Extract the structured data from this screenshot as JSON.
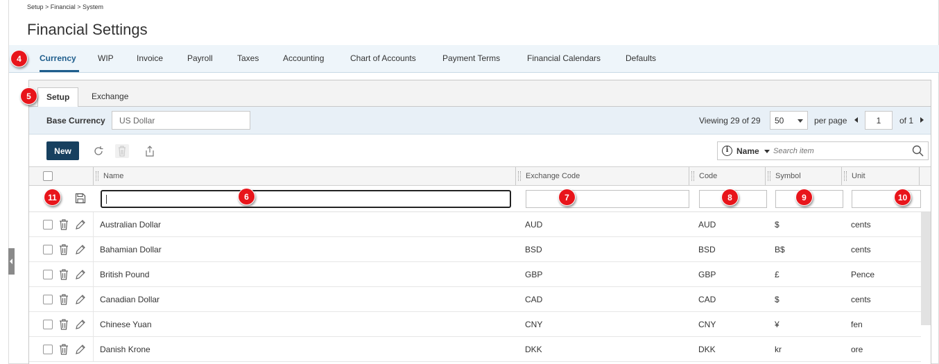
{
  "breadcrumb": "Setup > Financial > System",
  "page_title": "Financial Settings",
  "main_tabs": [
    {
      "label": "Currency",
      "active": true
    },
    {
      "label": "WIP"
    },
    {
      "label": "Invoice"
    },
    {
      "label": "Payroll"
    },
    {
      "label": "Taxes"
    },
    {
      "label": "Accounting"
    },
    {
      "label": "Chart of Accounts"
    },
    {
      "label": "Payment Terms"
    },
    {
      "label": "Financial Calendars"
    },
    {
      "label": "Defaults"
    }
  ],
  "sub_tabs": [
    {
      "label": "Setup",
      "active": true
    },
    {
      "label": "Exchange"
    }
  ],
  "base_currency": {
    "label": "Base Currency",
    "value": "US Dollar"
  },
  "paging": {
    "viewing_label": "Viewing",
    "viewing_value": "29 of 29",
    "per_page_value": "50",
    "per_page_label": "per page",
    "page_value": "1",
    "of_label": "of 1"
  },
  "toolbar": {
    "new_label": "New",
    "icons": [
      "refresh-icon",
      "trash-icon",
      "export-icon"
    ]
  },
  "search": {
    "field_label": "Name",
    "placeholder": "Search item"
  },
  "columns": [
    "Name",
    "Exchange Code",
    "Code",
    "Symbol",
    "Unit"
  ],
  "markers": [
    "4",
    "5",
    "6",
    "7",
    "8",
    "9",
    "10",
    "11"
  ],
  "rows": [
    {
      "name": "Australian Dollar",
      "exchange_code": "AUD",
      "code": "AUD",
      "symbol": "$",
      "unit": "cents"
    },
    {
      "name": "Bahamian Dollar",
      "exchange_code": "BSD",
      "code": "BSD",
      "symbol": "B$",
      "unit": "cents"
    },
    {
      "name": "British Pound",
      "exchange_code": "GBP",
      "code": "GBP",
      "symbol": "£",
      "unit": "Pence"
    },
    {
      "name": "Canadian Dollar",
      "exchange_code": "CAD",
      "code": "CAD",
      "symbol": "$",
      "unit": "cents"
    },
    {
      "name": "Chinese Yuan",
      "exchange_code": "CNY",
      "code": "CNY",
      "symbol": "¥",
      "unit": "fen"
    },
    {
      "name": "Danish Krone",
      "exchange_code": "DKK",
      "code": "DKK",
      "symbol": "kr",
      "unit": "ore"
    }
  ],
  "colors": {
    "accent": "#1e5d8c",
    "primary_button": "#17405f",
    "marker": "#e8151b"
  }
}
